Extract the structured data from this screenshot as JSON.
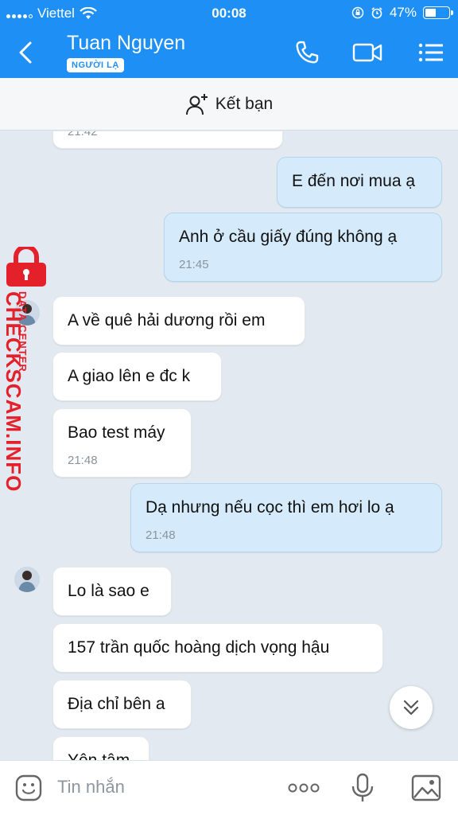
{
  "status_bar": {
    "carrier": "Viettel",
    "time": "00:08",
    "battery_percent": "47%",
    "battery_level": 0.47
  },
  "header": {
    "contact_name": "Tuan Nguyen",
    "badge": "NGƯỜI LẠ",
    "icons": [
      "back-icon",
      "phone-icon",
      "video-call-icon",
      "menu-icon"
    ]
  },
  "add_friend": {
    "label": "Kết bạn"
  },
  "messages": [
    {
      "side": "in",
      "text": "",
      "time": "21:42"
    },
    {
      "side": "out",
      "text": "E đến nơi mua ạ",
      "time": ""
    },
    {
      "side": "out",
      "text": "Anh ở cầu giấy đúng không ạ",
      "time": "21:45"
    },
    {
      "side": "in",
      "text": "A về quê hải dương rồi em",
      "time": ""
    },
    {
      "side": "in",
      "text": "A giao lên e đc k",
      "time": ""
    },
    {
      "side": "in",
      "text": "Bao test máy",
      "time": "21:48"
    },
    {
      "side": "out",
      "text": "Dạ nhưng nếu cọc thì em hơi lo ạ",
      "time": "21:48"
    },
    {
      "side": "in",
      "text": "Lo là sao e",
      "time": ""
    },
    {
      "side": "in",
      "text": "157 trần quốc hoàng dịch vọng hậu",
      "time": ""
    },
    {
      "side": "in",
      "text": "Địa chỉ bên a",
      "time": ""
    },
    {
      "side": "in",
      "text": "Yên tâm",
      "time": ""
    }
  ],
  "watermark": {
    "main": "CHECKSCAM.INFO",
    "sub": "DATA CENTER"
  },
  "input": {
    "placeholder": "Tin nhắn",
    "icons": [
      "sticker-icon",
      "more-icon",
      "microphone-icon",
      "image-icon"
    ]
  },
  "colors": {
    "header": "#1e8ff5",
    "outgoing_bubble": "#d5ebfb",
    "incoming_bubble": "#ffffff",
    "chat_bg": "#e2e9f1",
    "watermark": "#e4212b"
  }
}
